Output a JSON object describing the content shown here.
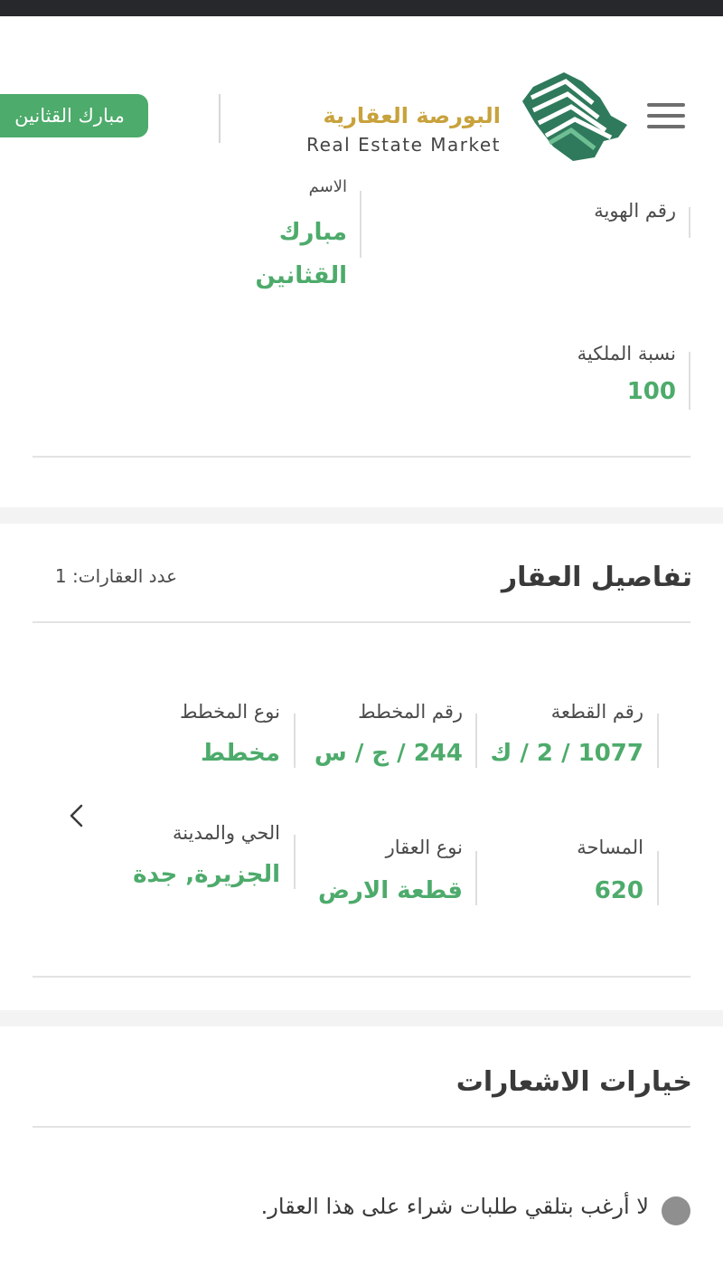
{
  "header": {
    "logo_ar": "البورصة العقارية",
    "logo_en": "Real Estate Market",
    "user_name": "مبارك القثانين",
    "brand_color": "#4dab6b",
    "logo_gold": "#c8a23c"
  },
  "owner": {
    "name_label": "الاسم",
    "name_value_line1": "مبارك",
    "name_value_line2": "القثانين",
    "id_label": "رقم الهوية",
    "ownership_label": "نسبة الملكية",
    "ownership_value": "100"
  },
  "property_details": {
    "title": "تفاصيل العقار",
    "count_label": "عدد العقارات: 1",
    "fields": {
      "plot_number_label": "رقم القطعة",
      "plot_number_value": "1077 / 2 / ك",
      "plan_number_label": "رقم المخطط",
      "plan_number_value": "244 / ج / س",
      "plan_type_label": "نوع المخطط",
      "plan_type_value": "مخطط",
      "area_label": "المساحة",
      "area_value": "620",
      "property_type_label": "نوع العقار",
      "property_type_value": "قطعة الارض",
      "district_city_label": "الحي والمدينة",
      "district_city_value": "الجزيرة, جدة"
    }
  },
  "notifications": {
    "title": "خيارات الاشعارات",
    "option_text": "لا أرغب بتلقي طلبات شراء على هذا العقار."
  },
  "icons": {
    "menu": "hamburger-menu-icon",
    "logo": "saudi-map-logo-icon",
    "chevron": "chevron-left-icon",
    "radio": "radio-button"
  }
}
